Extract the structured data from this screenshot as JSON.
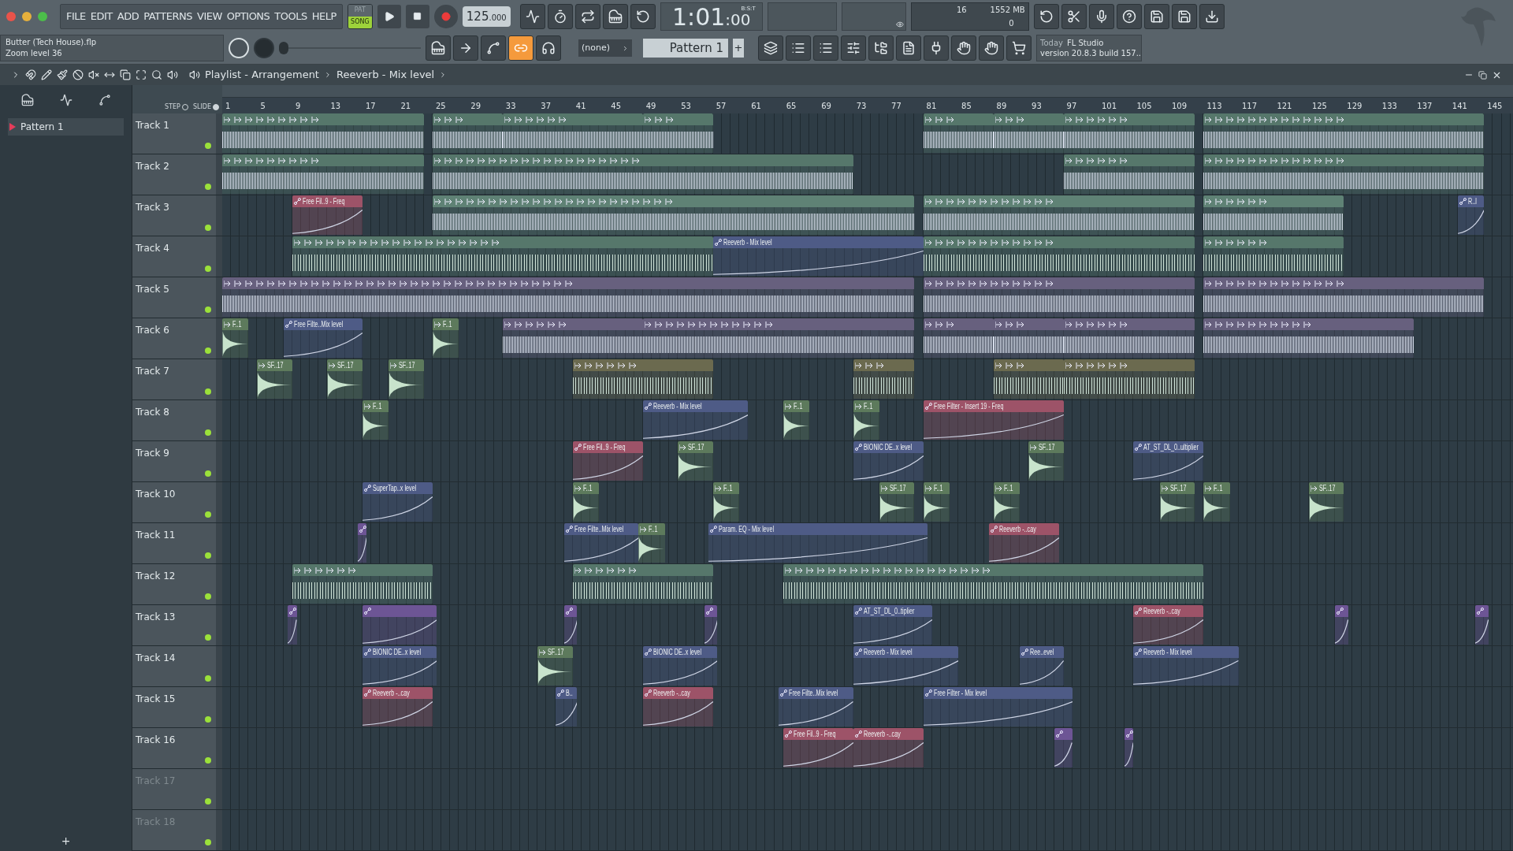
{
  "menu": [
    "FILE",
    "EDIT",
    "ADD",
    "PATTERNS",
    "VIEW",
    "OPTIONS",
    "TOOLS",
    "HELP"
  ],
  "mode": [
    {
      "label": "PAT",
      "selected": false
    },
    {
      "label": "SONG",
      "selected": true
    }
  ],
  "tempo": {
    "whole": "125",
    "fraction": ".000"
  },
  "time": {
    "main": "1:01",
    "sub": ":00",
    "unit": "B:S:T"
  },
  "memory": {
    "voices": "16",
    "ram": "1552 MB",
    "cpu": "0"
  },
  "hint": {
    "file": "Butter (Tech House).flp",
    "zoom": "Zoom level 36"
  },
  "song_position": {
    "level": 0
  },
  "pattern_picker": {
    "channel": "(none)",
    "pattern": "Pattern 1",
    "add": "+"
  },
  "news": {
    "when": "Today",
    "title": "FL Studio",
    "text": "version 20.8.3 build 157.."
  },
  "breadcrumb": [
    "Playlist - Arrangement",
    "Reeverb - Mix level"
  ],
  "step_slide": [
    {
      "label": "STEP",
      "on": false
    },
    {
      "label": "SLIDE",
      "on": true
    }
  ],
  "picker": {
    "items": [
      {
        "label": "Pattern 1",
        "selected": true
      }
    ],
    "add": "+"
  },
  "ruler": [
    "1",
    "5",
    "9",
    "13",
    "17",
    "21",
    "25",
    "29",
    "33",
    "37",
    "41",
    "45",
    "49",
    "53",
    "57",
    "61",
    "65",
    "69",
    "73",
    "77",
    "81",
    "85",
    "89",
    "93",
    "97",
    "101",
    "105",
    "109",
    "113",
    "117",
    "121",
    "125",
    "129",
    "133",
    "137",
    "141",
    "145"
  ],
  "tracks": [
    {
      "name": "Track 1",
      "dimmed": false,
      "clips": [
        {
          "kind": "pattern",
          "color": "#56776b"
        },
        {
          "kind": "pattern",
          "color": "#56776b"
        },
        {
          "kind": "pattern",
          "color": "#56776b"
        },
        {
          "kind": "pattern",
          "color": "#56776b"
        },
        {
          "kind": "pattern",
          "color": "#56776b"
        },
        {
          "kind": "pattern",
          "color": "#56776b"
        },
        {
          "kind": "pattern",
          "color": "#56776b"
        },
        {
          "kind": "pattern",
          "color": "#56776b"
        }
      ]
    },
    {
      "name": "Track 2",
      "dimmed": false,
      "clips": [
        {
          "kind": "pattern",
          "color": "#56776b"
        },
        {
          "kind": "pattern",
          "color": "#56776b"
        },
        {
          "kind": "pattern",
          "color": "#56776b"
        },
        {
          "kind": "pattern",
          "color": "#56776b"
        }
      ]
    },
    {
      "name": "Track 3",
      "dimmed": false,
      "clips": [
        {
          "kind": "automation",
          "label": "Free Fil..9 - Freq",
          "color": "#9d5368"
        },
        {
          "kind": "pattern",
          "color": "#5f8275"
        },
        {
          "kind": "pattern",
          "color": "#5f8275"
        },
        {
          "kind": "pattern",
          "color": "#5f8275"
        },
        {
          "kind": "automation",
          "label": "R..l",
          "color": "#4e5b86"
        }
      ]
    },
    {
      "name": "Track 4",
      "dimmed": false,
      "clips": [
        {
          "kind": "audio",
          "color": "#56776b"
        },
        {
          "kind": "automation",
          "label": "Reeverb - Mix level",
          "color": "#4e5b86"
        },
        {
          "kind": "audio",
          "color": "#56776b"
        },
        {
          "kind": "audio",
          "color": "#56776b"
        }
      ]
    },
    {
      "name": "Track 5",
      "dimmed": false,
      "clips": [
        {
          "kind": "pattern",
          "color": "#67607e"
        },
        {
          "kind": "pattern",
          "color": "#67607e"
        },
        {
          "kind": "pattern",
          "color": "#67607e"
        }
      ]
    },
    {
      "name": "Track 6",
      "dimmed": false,
      "clips": [
        {
          "kind": "shot",
          "label": "F..1",
          "color": "#5d7a5c"
        },
        {
          "kind": "automation",
          "label": "Free Filte..Mix level",
          "color": "#4e5b86"
        },
        {
          "kind": "shot",
          "label": "F..1",
          "color": "#5d7a5c"
        },
        {
          "kind": "pattern",
          "color": "#67607e"
        },
        {
          "kind": "pattern",
          "color": "#67607e"
        },
        {
          "kind": "pattern",
          "color": "#67607e"
        },
        {
          "kind": "pattern",
          "color": "#67607e"
        },
        {
          "kind": "pattern",
          "color": "#67607e"
        },
        {
          "kind": "pattern",
          "color": "#67607e"
        }
      ]
    },
    {
      "name": "Track 7",
      "dimmed": false,
      "clips": [
        {
          "kind": "shot",
          "label": "SF..17",
          "color": "#5d7a5c"
        },
        {
          "kind": "shot",
          "label": "SF..17",
          "color": "#5d7a5c"
        },
        {
          "kind": "shot",
          "label": "SF..17",
          "color": "#5d7a5c"
        },
        {
          "kind": "audio",
          "color": "#6b6a4f"
        },
        {
          "kind": "audio",
          "color": "#6b6a4f"
        },
        {
          "kind": "audio",
          "color": "#6b6a4f"
        },
        {
          "kind": "audio",
          "color": "#6b6a4f"
        }
      ]
    },
    {
      "name": "Track 8",
      "dimmed": false,
      "clips": [
        {
          "kind": "shot",
          "label": "F..1",
          "color": "#5d7a5c"
        },
        {
          "kind": "automation",
          "label": "Reeverb - Mix level",
          "color": "#4e5b86"
        },
        {
          "kind": "shot",
          "label": "F..1",
          "color": "#5d7a5c"
        },
        {
          "kind": "shot",
          "label": "F..1",
          "color": "#5d7a5c"
        },
        {
          "kind": "automation",
          "label": "Free Filter - Insert 19 - Freq",
          "color": "#9d5368"
        }
      ]
    },
    {
      "name": "Track 9",
      "dimmed": false,
      "clips": [
        {
          "kind": "automation",
          "label": "Free Fil..9 - Freq",
          "color": "#9d5368"
        },
        {
          "kind": "shot",
          "label": "SF..17",
          "color": "#5d7a5c"
        },
        {
          "kind": "automation",
          "label": "BIONIC DE..x level",
          "color": "#4e5b86"
        },
        {
          "kind": "shot",
          "label": "SF..17",
          "color": "#5d7a5c"
        },
        {
          "kind": "automation",
          "label": "AT_ST_DL_0..ultiplier",
          "color": "#4e5b86"
        }
      ]
    },
    {
      "name": "Track 10",
      "dimmed": false,
      "clips": [
        {
          "kind": "automation",
          "label": "SuperTap..x level",
          "color": "#4e5b86"
        },
        {
          "kind": "shot",
          "label": "F..1",
          "color": "#5d7a5c"
        },
        {
          "kind": "shot",
          "label": "F..1",
          "color": "#5d7a5c"
        },
        {
          "kind": "shot",
          "label": "SF..17",
          "color": "#5d7a5c"
        },
        {
          "kind": "shot",
          "label": "F..1",
          "color": "#5d7a5c"
        },
        {
          "kind": "shot",
          "label": "F..1",
          "color": "#5d7a5c"
        },
        {
          "kind": "shot",
          "label": "SF..17",
          "color": "#5d7a5c"
        },
        {
          "kind": "shot",
          "label": "F..1",
          "color": "#5d7a5c"
        },
        {
          "kind": "shot",
          "label": "SF..17",
          "color": "#5d7a5c"
        }
      ]
    },
    {
      "name": "Track 11",
      "dimmed": false,
      "clips": [
        {
          "kind": "automation",
          "color": "#6d5595"
        },
        {
          "kind": "automation",
          "label": "Free Filte..Mix level",
          "color": "#4e5b86"
        },
        {
          "kind": "shot",
          "label": "F..1",
          "color": "#5d7a5c"
        },
        {
          "kind": "automation",
          "label": "Param. EQ - Mix level",
          "color": "#4e5b86"
        },
        {
          "kind": "automation",
          "label": "Reeverb -..cay",
          "color": "#9d5368"
        }
      ]
    },
    {
      "name": "Track 12",
      "dimmed": false,
      "clips": [
        {
          "kind": "audio",
          "color": "#56776b"
        },
        {
          "kind": "audio",
          "color": "#56776b"
        },
        {
          "kind": "audio",
          "color": "#56776b"
        }
      ]
    },
    {
      "name": "Track 13",
      "dimmed": false,
      "clips": [
        {
          "kind": "automation",
          "color": "#6d5595"
        },
        {
          "kind": "automation",
          "color": "#6d5595"
        },
        {
          "kind": "automation",
          "color": "#6d5595"
        },
        {
          "kind": "automation",
          "color": "#6d5595"
        },
        {
          "kind": "automation",
          "label": "AT_ST_DL_0..tiplier",
          "color": "#4e5b86"
        },
        {
          "kind": "automation",
          "label": "Reeverb -..cay",
          "color": "#9d5368"
        },
        {
          "kind": "automation",
          "color": "#6d5595"
        },
        {
          "kind": "automation",
          "color": "#6d5595"
        }
      ]
    },
    {
      "name": "Track 14",
      "dimmed": false,
      "clips": [
        {
          "kind": "automation",
          "label": "BIONIC DE..x level",
          "color": "#4e5b86"
        },
        {
          "kind": "shot",
          "label": "SF..17",
          "color": "#5d7a5c"
        },
        {
          "kind": "automation",
          "label": "BIONIC DE..x level",
          "color": "#4e5b86"
        },
        {
          "kind": "automation",
          "label": "Reeverb - Mix level",
          "color": "#4e5b86"
        },
        {
          "kind": "automation",
          "label": "Ree..evel",
          "color": "#4e5b86"
        },
        {
          "kind": "automation",
          "label": "Reeverb - Mix level",
          "color": "#4e5b86"
        }
      ]
    },
    {
      "name": "Track 15",
      "dimmed": false,
      "clips": [
        {
          "kind": "automation",
          "label": "Reeverb -..cay",
          "color": "#9d5368"
        },
        {
          "kind": "automation",
          "label": "B..",
          "color": "#4e5b86"
        },
        {
          "kind": "automation",
          "label": "Reeverb -..cay",
          "color": "#9d5368"
        },
        {
          "kind": "automation",
          "label": "Free Filte..Mix level",
          "color": "#4e5b86"
        },
        {
          "kind": "automation",
          "label": "Free Filter - Mix level",
          "color": "#4e5b86"
        }
      ]
    },
    {
      "name": "Track 16",
      "dimmed": false,
      "clips": [
        {
          "kind": "automation",
          "label": "Free Fil..9 - Freq",
          "color": "#9d5368"
        },
        {
          "kind": "automation",
          "label": "Reeverb -..cay",
          "color": "#9d5368"
        },
        {
          "kind": "automation",
          "color": "#6d5595"
        },
        {
          "kind": "automation",
          "color": "#6d5595"
        }
      ]
    },
    {
      "name": "Track 17",
      "dimmed": true
    },
    {
      "name": "Track 18",
      "dimmed": true
    }
  ]
}
